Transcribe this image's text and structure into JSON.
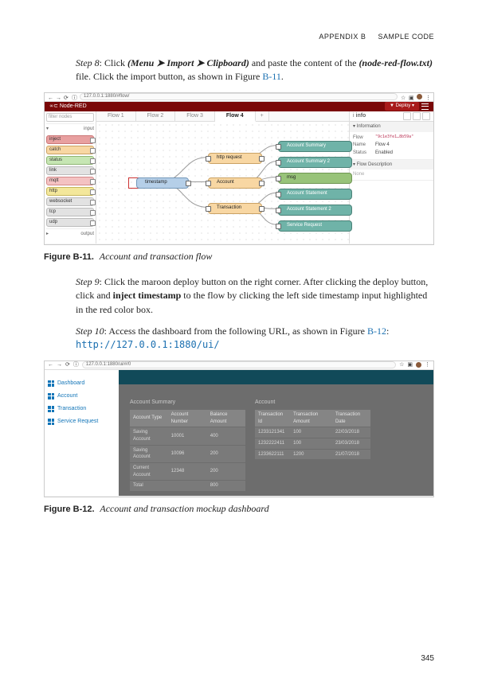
{
  "header": {
    "appendix": "APPENDIX B",
    "title": "SAMPLE CODE"
  },
  "page_number": "345",
  "step8": {
    "label": "Step 8",
    "prefix": "Click",
    "menu": "(Menu ➤ Import ➤ Clipboard)",
    "mid": "and paste the content of the",
    "file": "(node-red-flow.txt)",
    "suffix": "file. Click the import button, as shown in Figure",
    "figref": "B-11",
    "end": "."
  },
  "fig11": {
    "label": "Figure B-11.",
    "caption": "Account and transaction flow"
  },
  "step9": {
    "label": "Step 9",
    "text1": ": Click the maroon deploy button on the right corner. After clicking the deploy button, click and",
    "bold": "inject timestamp",
    "text2": "to the flow by clicking the left side timestamp input highlighted in the red color box."
  },
  "step10": {
    "label": "Step 10",
    "text": ": Access the dashboard from the following URL, as shown in Figure",
    "figref": "B-12",
    "colon": ":",
    "url": "http://127.0.0.1:1880/ui/"
  },
  "fig12": {
    "label": "Figure B-12.",
    "caption": "Account and transaction mockup dashboard"
  },
  "shot1": {
    "addr": "127.0.0.1:1880/#flow/",
    "brand": "Node-RED",
    "deploy": "Deploy",
    "filter": "filter nodes",
    "palette_sections": {
      "input": "input",
      "output": "output"
    },
    "palette": [
      {
        "cls": "pn-red",
        "label": "inject"
      },
      {
        "cls": "pn-orange",
        "label": "catch"
      },
      {
        "cls": "pn-green",
        "label": "status"
      },
      {
        "cls": "pn-grey",
        "label": "link"
      },
      {
        "cls": "pn-pink",
        "label": "mqtt"
      },
      {
        "cls": "pn-yellow",
        "label": "http"
      },
      {
        "cls": "pn-grey",
        "label": "websocket"
      },
      {
        "cls": "pn-grey",
        "label": "tcp"
      },
      {
        "cls": "pn-grey",
        "label": "udp"
      }
    ],
    "tabs": [
      "Flow 1",
      "Flow 2",
      "Flow 3",
      "Flow 4"
    ],
    "active_tab": 3,
    "nodes": {
      "timestamp": "timestamp",
      "http": "http request",
      "account": "Account",
      "transaction": "Transaction",
      "out": [
        "Account Summary",
        "Account Summary 2",
        "msg",
        "Account Statement",
        "Account Statement 2",
        "Service Request"
      ]
    },
    "info": {
      "tab": "info",
      "section": "Information",
      "flow_k": "Flow",
      "flow_v": "\"9c1e3fe1…8b59a\"",
      "name_k": "Name",
      "name_v": "Flow 4",
      "status_k": "Status",
      "status_v": "Enabled",
      "desc_hd": "Flow Description",
      "desc_body": "None"
    }
  },
  "shot2": {
    "addr": "127.0.0.1:1880/ui/#/0",
    "nav": [
      "Dashboard",
      "Account",
      "Transaction",
      "Service Request"
    ],
    "card1": {
      "title": "Account Summary",
      "headers": [
        "Account Type",
        "Account Number",
        "Balance Amount"
      ],
      "rows": [
        [
          "Saving Account",
          "10001",
          "400"
        ],
        [
          "Saving Account",
          "10096",
          "200"
        ],
        [
          "Current Account",
          "12348",
          "200"
        ],
        [
          "Total",
          "",
          "800"
        ]
      ]
    },
    "card2": {
      "title": "Account",
      "headers": [
        "Transaction Id",
        "Transaction Amount",
        "Transaction Date"
      ],
      "rows": [
        [
          "1233121341",
          "100",
          "22/03/2018"
        ],
        [
          "1232222411",
          "100",
          "23/03/2018"
        ],
        [
          "1233622111",
          "1200",
          "21/07/2018"
        ]
      ]
    }
  }
}
